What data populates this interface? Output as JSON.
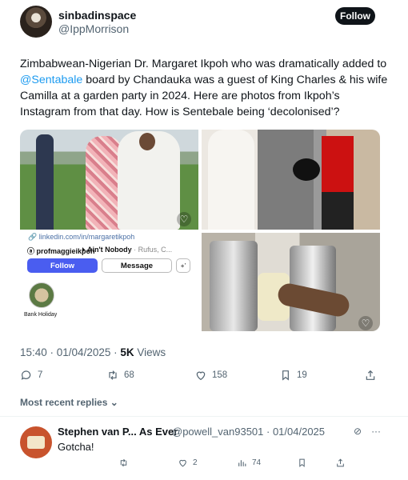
{
  "author": {
    "display_name": "sinbadinspace",
    "handle": "@IppMorrison",
    "follow_label": "Follow"
  },
  "tweet": {
    "text_before": "Zimbabwean-Nigerian Dr. Margaret Ikpoh who was dramatically added to ",
    "mention": "@Sentabale",
    "text_after": " board by Chandauka was a guest of King Charles & his wife Camilla at a garden party in 2024. Here are photos from Ikpoh’s Instagram from that day. How is Sentebale being ‘decolonised’?"
  },
  "media": {
    "profile_screenshot": {
      "link": "linkedin.com/in/margaretikpoh",
      "username": "profmaggieikpoh",
      "song": "Ain't Nobody",
      "song_artist": "· Rufus, C...",
      "follow_label": "Follow",
      "message_label": "Message",
      "adduser_glyph": "+’",
      "highlight_label": "Bank Holiday"
    }
  },
  "meta": {
    "time": "15:40 · 01/04/2025 · ",
    "views_count": "5K",
    "views_label": " Views"
  },
  "actions": {
    "replies": "7",
    "reposts": "68",
    "likes": "158",
    "bookmarks": "19"
  },
  "sort_label": "Most recent replies",
  "reply": {
    "display_name": "Stephen van P... As Ever",
    "handle_date": "@powell_van93501 · 01/04/2025",
    "text": "Gotcha!",
    "likes": "2",
    "views": "74",
    "more": "···"
  },
  "colors": {
    "accent": "#1d9bf0",
    "text": "#0f1419",
    "muted": "#536471"
  }
}
